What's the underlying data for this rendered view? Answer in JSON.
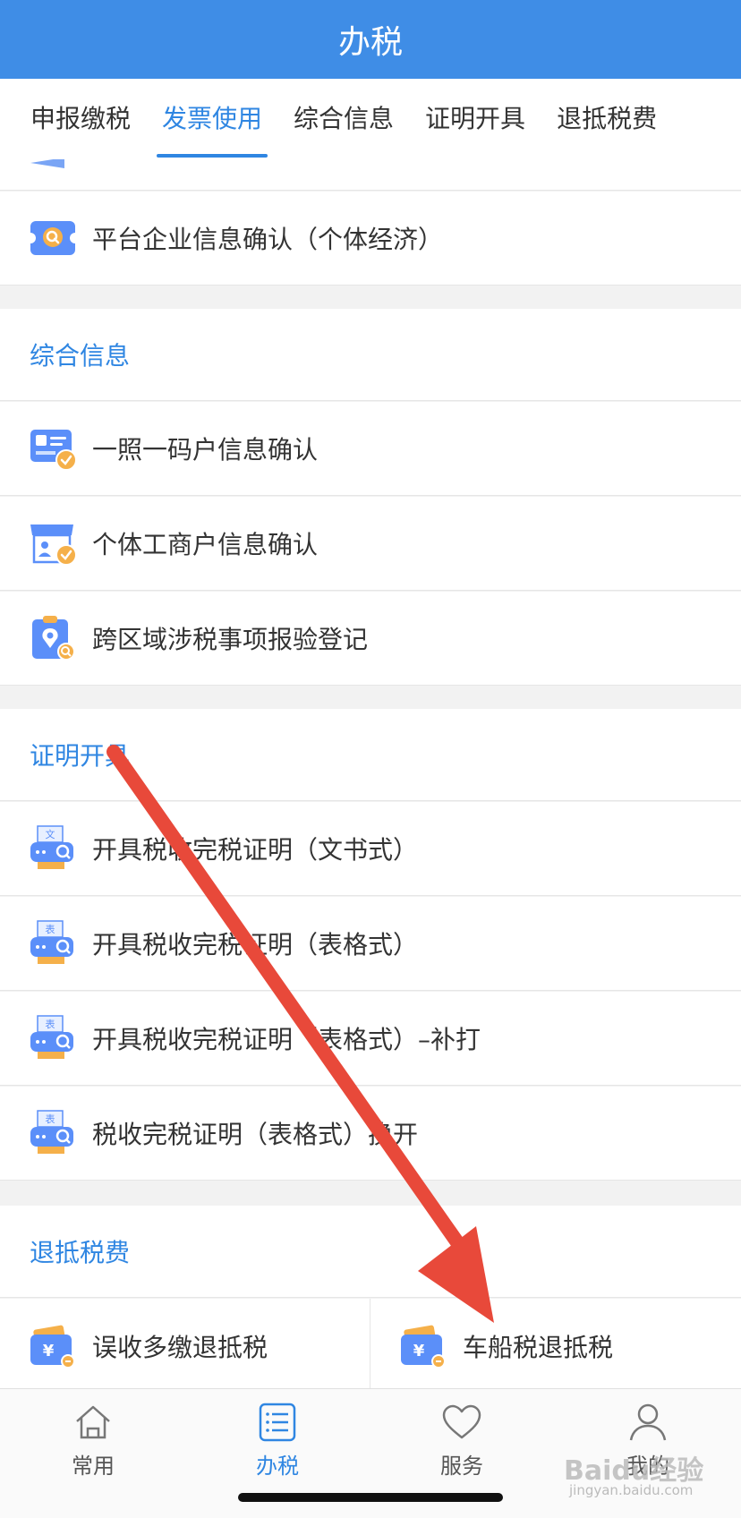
{
  "header": {
    "title": "办税"
  },
  "tabs": [
    {
      "label": "申报缴税"
    },
    {
      "label": "发票使用"
    },
    {
      "label": "综合信息"
    },
    {
      "label": "证明开具"
    },
    {
      "label": "退抵税费"
    }
  ],
  "platform_item": {
    "label": "平台企业信息确认（个体经济）"
  },
  "sections": {
    "info": {
      "title": "综合信息",
      "items": [
        {
          "label": "一照一码户信息确认"
        },
        {
          "label": "个体工商户信息确认"
        },
        {
          "label": "跨区域涉税事项报验登记"
        }
      ]
    },
    "cert": {
      "title": "证明开具",
      "items": [
        {
          "label": "开具税收完税证明（文书式）",
          "badge": "文"
        },
        {
          "label": "开具税收完税证明（表格式）",
          "badge": "表"
        },
        {
          "label": "开具税收完税证明（表格式）–补打",
          "badge": "表"
        },
        {
          "label": "税收完税证明（表格式）换开",
          "badge": "表"
        }
      ]
    },
    "refund": {
      "title": "退抵税费",
      "items": [
        {
          "label": "误收多缴退抵税"
        },
        {
          "label": "车船税退抵税"
        }
      ]
    }
  },
  "bottom_nav": [
    {
      "label": "常用",
      "icon": "home-icon"
    },
    {
      "label": "办税",
      "icon": "list-icon"
    },
    {
      "label": "服务",
      "icon": "heart-icon"
    },
    {
      "label": "我的",
      "icon": "user-icon"
    }
  ],
  "watermark": {
    "text": "Baidu经验",
    "sub": "jingyan.baidu.com"
  },
  "colors": {
    "brand": "#3f8de6",
    "accent": "#2f86e2",
    "arrow": "#e8493a"
  }
}
